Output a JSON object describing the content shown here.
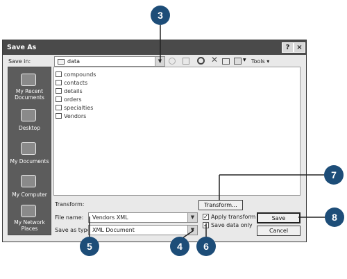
{
  "dialog": {
    "title": "Save As",
    "help_button": "?",
    "close_button": "×"
  },
  "toolbar": {
    "save_in_label": "Save in:",
    "save_in_value": "data",
    "tools_label": "Tools"
  },
  "places": [
    {
      "label": "My Recent Documents",
      "icon": "recent-documents-icon"
    },
    {
      "label": "Desktop",
      "icon": "desktop-icon"
    },
    {
      "label": "My Documents",
      "icon": "my-documents-icon"
    },
    {
      "label": "My Computer",
      "icon": "my-computer-icon"
    },
    {
      "label": "My Network Places",
      "icon": "network-places-icon"
    }
  ],
  "files": [
    "compounds",
    "contacts",
    "details",
    "orders",
    "specialties",
    "Vendors"
  ],
  "form": {
    "transform_label": "Transform:",
    "transform_button": "Transform...",
    "file_name_label": "File name:",
    "file_name_value": "Vendors XML",
    "save_as_type_label": "Save as type:",
    "save_as_type_value": "XML Document",
    "apply_transform_label": "Apply transform",
    "apply_transform_checked": true,
    "save_data_only_label": "Save data only",
    "save_data_only_checked": true
  },
  "buttons": {
    "save": "Save",
    "cancel": "Cancel"
  },
  "callouts": [
    "3",
    "4",
    "5",
    "6",
    "7",
    "8"
  ],
  "colors": {
    "callout": "#1d4d78"
  }
}
